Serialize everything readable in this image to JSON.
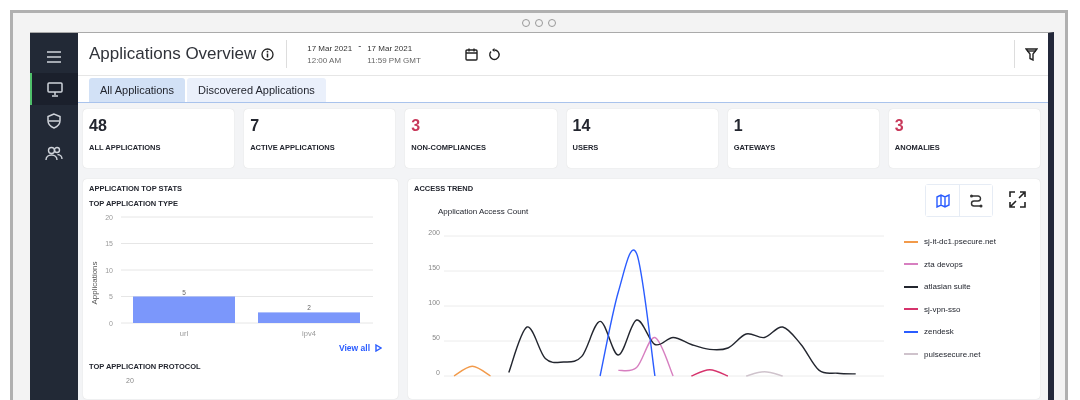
{
  "sidebar": {
    "items": [
      {
        "kind": "menu",
        "selected": false
      },
      {
        "kind": "monitor",
        "selected": true
      },
      {
        "kind": "shield",
        "selected": false
      },
      {
        "kind": "users",
        "selected": false
      }
    ]
  },
  "header": {
    "title": "Applications Overview",
    "date_from": {
      "date": "17 Mar 2021",
      "time": "12:00 AM"
    },
    "separator": "-",
    "date_to": {
      "date": "17 Mar 2021",
      "time": "11:59 PM GMT"
    }
  },
  "tabs": [
    {
      "label": "All Applications",
      "selected": true
    },
    {
      "label": "Discovered Applications",
      "selected": false
    }
  ],
  "stats": [
    {
      "value": "48",
      "label": "ALL APPLICATIONS",
      "color": "#23262f"
    },
    {
      "value": "7",
      "label": "ACTIVE APPLICATIONS",
      "color": "#23262f"
    },
    {
      "value": "3",
      "label": "NON-COMPLIANCES",
      "color": "#c8385a"
    },
    {
      "value": "14",
      "label": "USERS",
      "color": "#23262f"
    },
    {
      "value": "1",
      "label": "GATEWAYS",
      "color": "#23262f"
    },
    {
      "value": "3",
      "label": "ANOMALIES",
      "color": "#c8385a"
    }
  ],
  "top_stats": {
    "title": "APPLICATION TOP STATS",
    "type_title": "TOP APPLICATION TYPE",
    "chart_data": {
      "type": "bar",
      "ylabel": "Applications",
      "categories": [
        "url",
        "ipv4"
      ],
      "values": [
        5,
        2
      ],
      "ylim": [
        0,
        20
      ],
      "yticks": [
        0,
        5,
        10,
        15,
        20
      ],
      "grid": true,
      "data_labels": true
    },
    "view_all": "View all",
    "protocol_title": "TOP APPLICATION PROTOCOL",
    "protocol_tick": "20"
  },
  "access_trend": {
    "title": "ACCESS TREND",
    "chart_data": {
      "type": "line",
      "title": "Application Access Count",
      "ylim": [
        0,
        200
      ],
      "yticks": [
        0,
        50,
        100,
        150,
        200
      ],
      "grid": true,
      "series": [
        {
          "name": "sj-it-dc1.psecure.net",
          "color": "#f29a4a",
          "values": [
            0,
            14,
            0,
            null,
            null,
            null,
            null,
            null,
            null,
            null,
            null,
            null,
            null,
            null,
            null,
            null,
            null,
            null,
            null,
            null,
            null,
            null,
            null,
            null
          ]
        },
        {
          "name": "zta devops",
          "color": "#d77fc0",
          "values": [
            null,
            null,
            null,
            null,
            null,
            null,
            null,
            null,
            null,
            8,
            12,
            55,
            0,
            null,
            null,
            null,
            null,
            null,
            null,
            null,
            null,
            null,
            null,
            null
          ]
        },
        {
          "name": "atlasian suite",
          "color": "#23262f",
          "values": [
            null,
            null,
            null,
            5,
            70,
            25,
            20,
            28,
            78,
            30,
            80,
            45,
            55,
            45,
            38,
            40,
            60,
            55,
            70,
            45,
            8,
            4,
            3,
            null
          ]
        },
        {
          "name": "sj-vpn-sso",
          "color": "#d6336c",
          "values": [
            null,
            null,
            null,
            null,
            null,
            null,
            null,
            null,
            null,
            null,
            null,
            null,
            null,
            0,
            9,
            0,
            null,
            null,
            null,
            null,
            null,
            null,
            null,
            null
          ]
        },
        {
          "name": "zendesk",
          "color": "#2a5cff",
          "values": [
            null,
            null,
            null,
            null,
            null,
            null,
            null,
            null,
            0,
            120,
            175,
            0,
            null,
            null,
            null,
            null,
            null,
            null,
            null,
            null,
            null,
            null,
            null,
            null
          ]
        },
        {
          "name": "pulsesecure.net",
          "color": "#cfc3cc",
          "values": [
            null,
            null,
            null,
            null,
            null,
            null,
            null,
            null,
            null,
            null,
            null,
            null,
            null,
            null,
            null,
            null,
            0,
            6,
            0,
            null,
            null,
            null,
            null,
            null
          ]
        }
      ]
    },
    "view_modes": [
      {
        "kind": "map",
        "selected": true
      },
      {
        "kind": "route",
        "selected": false
      }
    ]
  }
}
